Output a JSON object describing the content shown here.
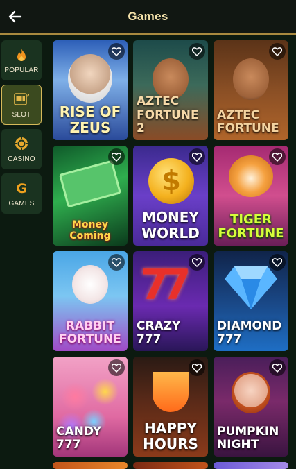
{
  "header": {
    "title": "Games",
    "back_icon": "arrow-left-icon"
  },
  "colors": {
    "accent": "#a8893f",
    "sidebar_bg": "#1a3320",
    "active_border": "#d6b95a",
    "page_bg": "#0c1a10"
  },
  "sidebar": {
    "items": [
      {
        "label": "POPULAR",
        "icon": "flame-icon",
        "active": false
      },
      {
        "label": "SLOT",
        "icon": "slot-machine-icon",
        "active": true
      },
      {
        "label": "CASINO",
        "icon": "chip-icon",
        "active": false
      },
      {
        "label": "GAMES",
        "icon": "letter-g-icon",
        "active": false
      }
    ]
  },
  "games": [
    {
      "title": "RISE OF\nZEUS"
    },
    {
      "title": "AZTEC\nFORTUNE 2"
    },
    {
      "title": "AZTEC\nFORTUNE"
    },
    {
      "title": "Money Coming"
    },
    {
      "title": "MONEY\nWORLD"
    },
    {
      "title": "TIGER\nFORTUNE"
    },
    {
      "title": "RABBIT\nFORTUNE"
    },
    {
      "title": "CRAZY 777"
    },
    {
      "title": "DIAMOND\n777"
    },
    {
      "title": "CANDY 777"
    },
    {
      "title": "HAPPY\nHOURS"
    },
    {
      "title": "PUMPKIN\nNIGHT"
    }
  ],
  "favorite_icon": "heart-outline-icon"
}
